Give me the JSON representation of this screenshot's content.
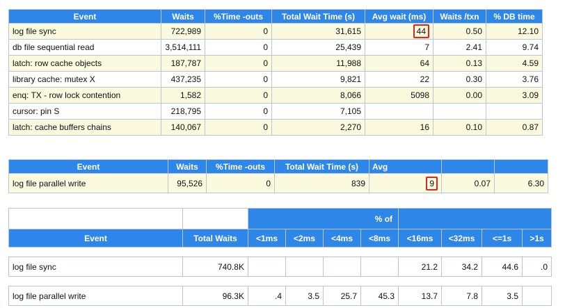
{
  "wait_events": {
    "headers": [
      "Event",
      "Waits",
      "%Time -outs",
      "Total Wait Time (s)",
      "Avg wait (ms)",
      "Waits /txn",
      "% DB time"
    ],
    "rows": [
      [
        "log file sync",
        "722,989",
        "0",
        "31,615",
        "44",
        "0.50",
        "12.10"
      ],
      [
        "db file sequential read",
        "3,514,111",
        "0",
        "25,439",
        "7",
        "2.41",
        "9.74"
      ],
      [
        "latch: row cache objects",
        "187,787",
        "0",
        "11,988",
        "64",
        "0.13",
        "4.59"
      ],
      [
        "library cache: mutex X",
        "437,235",
        "0",
        "9,821",
        "22",
        "0.30",
        "3.76"
      ],
      [
        "enq: TX - row lock contention",
        "1,582",
        "0",
        "8,066",
        "5098",
        "0.00",
        "3.09"
      ],
      [
        "cursor: pin S",
        "218,795",
        "0",
        "7,105",
        "",
        "",
        ""
      ],
      [
        "latch: cache buffers chains",
        "140,067",
        "0",
        "2,270",
        "16",
        "0.10",
        "0.87"
      ]
    ]
  },
  "bg_events": {
    "headers": [
      "Event",
      "Waits",
      "%Time -outs",
      "Total Wait Time (s)",
      "Avg",
      "",
      ""
    ],
    "rows": [
      [
        "log file parallel write",
        "95,526",
        "0",
        "839",
        "9",
        "0.07",
        "6.30"
      ]
    ]
  },
  "histogram": {
    "group_label": "% of",
    "headers": [
      "Event",
      "Total Waits",
      "<1ms",
      "<2ms",
      "<4ms",
      "<8ms",
      "<16ms",
      "<32ms",
      "<=1s",
      ">1s"
    ],
    "rows": [
      [
        "log file sync",
        "740.8K",
        "",
        "",
        "",
        "",
        "21.2",
        "34.2",
        "44.6",
        ".0"
      ],
      [
        "log file parallel write",
        "96.3K",
        ".4",
        "3.5",
        "25.7",
        "45.3",
        "13.7",
        "7.8",
        "3.5",
        ""
      ]
    ]
  }
}
